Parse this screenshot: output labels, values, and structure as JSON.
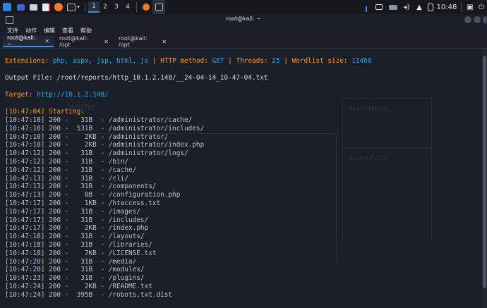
{
  "panel": {
    "workspaces": [
      "1",
      "2",
      "3",
      "4"
    ],
    "clock": "10:48"
  },
  "window": {
    "title": "root@kali: ~"
  },
  "menu": [
    "文件",
    "动作",
    "编辑",
    "查看",
    "帮助"
  ],
  "tabs": [
    {
      "label": "root@kali: ~",
      "close": "✕"
    },
    {
      "label": "root@kali: /opt",
      "close": "✕"
    },
    {
      "label": "root@kali: /opt",
      "close": "✕"
    }
  ],
  "terminal": {
    "header": {
      "ext_label": "Extensions:",
      "ext_value": "php, aspx, jsp, html, js",
      "method_label": "HTTP method:",
      "method_value": "GET",
      "threads_label": "Threads:",
      "threads_value": "25",
      "wordlist_label": "Wordlist size:",
      "wordlist_value": "11460",
      "sep": "|"
    },
    "output_file": "Output File: /root/reports/http_10.1.2.148/__24-04-14_10-47-04.txt",
    "target_label": "Target:",
    "target_value": "http://10.1.2.148/",
    "starting": "[10:47:04] Starting:",
    "rows": [
      "[10:47:10] 200 -   31B  - /administrator/cache/",
      "[10:47:10] 200 -  531B  - /administrator/includes/",
      "[10:47:10] 200 -    2KB - /administrator/",
      "[10:47:10] 200 -    2KB - /administrator/index.php",
      "[10:47:12] 200 -   31B  - /administrator/logs/",
      "[10:47:12] 200 -   31B  - /bin/",
      "[10:47:12] 200 -   31B  - /cache/",
      "[10:47:13] 200 -   31B  - /cli/",
      "[10:47:13] 200 -   31B  - /components/",
      "[10:47:13] 200 -    0B  - /configuration.php",
      "[10:47:17] 200 -    1KB - /htaccess.txt",
      "[10:47:17] 200 -   31B  - /images/",
      "[10:47:17] 200 -   31B  - /includes/",
      "[10:47:17] 200 -    2KB - /index.php",
      "[10:47:18] 200 -   31B  - /layouts/",
      "[10:47:18] 200 -   31B  - /libraries/",
      "[10:47:18] 200 -    7KB - /LICENSE.txt",
      "[10:47:20] 200 -   31B  - /media/",
      "[10:47:20] 200 -   31B  - /modules/",
      "[10:47:23] 200 -   31B  - /plugins/",
      "[10:47:24] 200 -    2KB - /README.txt",
      "[10:47:24] 200 -  395B  - /robots.txt.dist"
    ]
  },
  "background_page": {
    "home": "Home",
    "main_menu": "Main Menu",
    "login_form": "Login Form"
  },
  "colors": {
    "accent": "#3b8eea",
    "blue": "#2aa8f2",
    "yellow": "#f2c744",
    "orange": "#f59a23"
  }
}
